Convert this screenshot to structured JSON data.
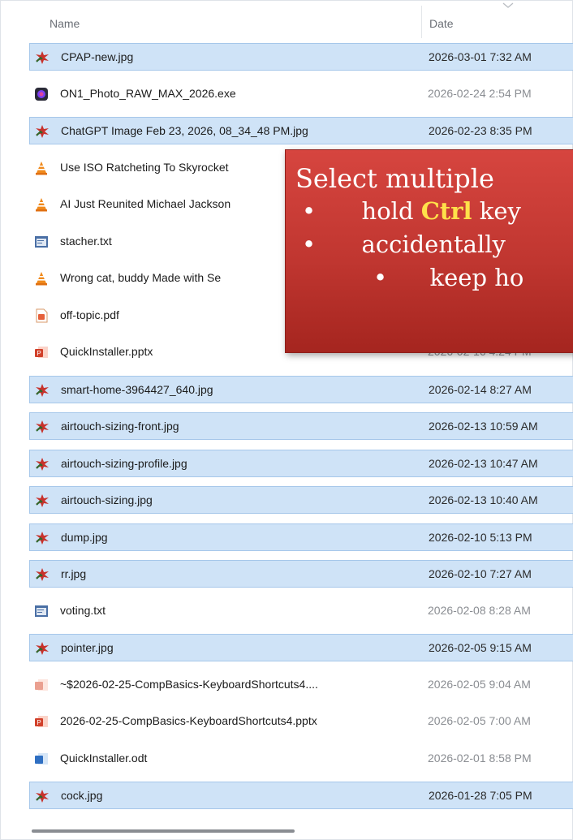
{
  "columns": {
    "name": "Name",
    "date": "Date"
  },
  "files": [
    {
      "name": "CPAP-new.jpg",
      "date": "2026-03-01 7:32 AM",
      "selected": true,
      "icon": "jpg-image-icon"
    },
    {
      "name": "ON1_Photo_RAW_MAX_2026.exe",
      "date": "2026-02-24 2:54 PM",
      "selected": false,
      "icon": "exe-app-icon"
    },
    {
      "name": "ChatGPT Image Feb 23, 2026, 08_34_48 PM.jpg",
      "date": "2026-02-23 8:35 PM",
      "selected": true,
      "icon": "jpg-image-icon"
    },
    {
      "name": "Use ISO Ratcheting To Skyrocket",
      "date": "",
      "selected": false,
      "icon": "vlc-media-icon"
    },
    {
      "name": "AI Just Reunited Michael Jackson",
      "date": "",
      "selected": false,
      "icon": "vlc-media-icon"
    },
    {
      "name": "stacher.txt",
      "date": "",
      "selected": false,
      "icon": "text-file-icon"
    },
    {
      "name": "Wrong cat, buddy Made with Se",
      "date": "",
      "selected": false,
      "icon": "vlc-media-icon"
    },
    {
      "name": "off-topic.pdf",
      "date": "",
      "selected": false,
      "icon": "pdf-file-icon"
    },
    {
      "name": "QuickInstaller.pptx",
      "date": "2026-02-16 4:24 PM",
      "selected": false,
      "icon": "pptx-file-icon"
    },
    {
      "name": "smart-home-3964427_640.jpg",
      "date": "2026-02-14 8:27 AM",
      "selected": true,
      "icon": "jpg-image-icon"
    },
    {
      "name": "airtouch-sizing-front.jpg",
      "date": "2026-02-13 10:59 AM",
      "selected": true,
      "icon": "jpg-image-icon"
    },
    {
      "name": "airtouch-sizing-profile.jpg",
      "date": "2026-02-13 10:47 AM",
      "selected": true,
      "icon": "jpg-image-icon"
    },
    {
      "name": "airtouch-sizing.jpg",
      "date": "2026-02-13 10:40 AM",
      "selected": true,
      "icon": "jpg-image-icon"
    },
    {
      "name": "dump.jpg",
      "date": "2026-02-10 5:13 PM",
      "selected": true,
      "icon": "jpg-image-icon"
    },
    {
      "name": "rr.jpg",
      "date": "2026-02-10 7:27 AM",
      "selected": true,
      "icon": "jpg-image-icon"
    },
    {
      "name": "voting.txt",
      "date": "2026-02-08 8:28 AM",
      "selected": false,
      "icon": "text-file-icon"
    },
    {
      "name": "pointer.jpg",
      "date": "2026-02-05 9:15 AM",
      "selected": true,
      "icon": "jpg-image-icon"
    },
    {
      "name": "~$2026-02-25-CompBasics-KeyboardShortcuts4....",
      "date": "2026-02-05 9:04 AM",
      "selected": false,
      "icon": "pptx-temp-file-icon"
    },
    {
      "name": "2026-02-25-CompBasics-KeyboardShortcuts4.pptx",
      "date": "2026-02-05 7:00 AM",
      "selected": false,
      "icon": "pptx-file-icon"
    },
    {
      "name": "QuickInstaller.odt",
      "date": "2026-02-01 8:58 PM",
      "selected": false,
      "icon": "odt-file-icon"
    },
    {
      "name": "cock.jpg",
      "date": "2026-01-28 7:05 PM",
      "selected": true,
      "icon": "jpg-image-icon"
    }
  ],
  "callout": {
    "title": "Select multiple",
    "line1_pre": "hold ",
    "line1_key": "Ctrl",
    "line1_post": " key",
    "line2": "accidentally",
    "line3": "keep ho",
    "bullet": "•"
  },
  "colors": {
    "selection": "#cfe3f7",
    "callout": "#c03630",
    "highlight": "#ffe14a"
  }
}
